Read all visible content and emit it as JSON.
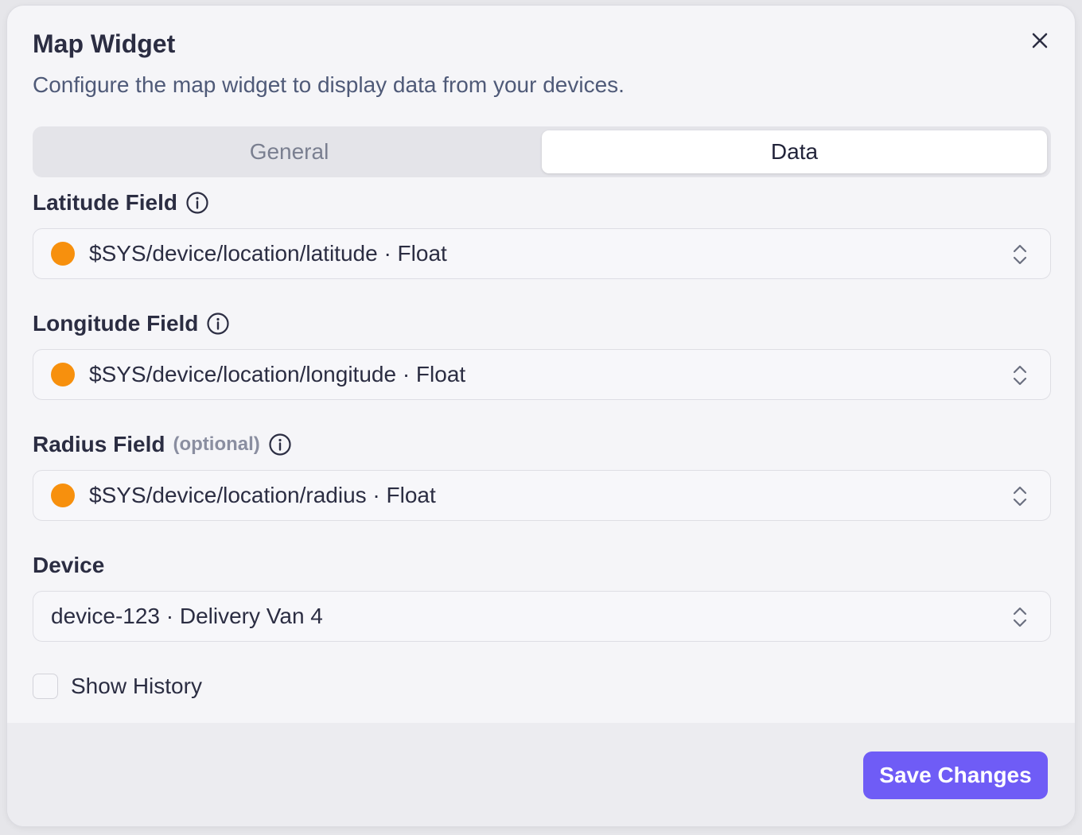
{
  "dialog": {
    "title": "Map Widget",
    "subtitle": "Configure the map widget to display data from your devices."
  },
  "tabs": [
    {
      "label": "General",
      "active": false
    },
    {
      "label": "Data",
      "active": true
    }
  ],
  "fields": {
    "latitude": {
      "label": "Latitude Field",
      "value": "$SYS/device/location/latitude · Float",
      "dot_color": "#f7900d"
    },
    "longitude": {
      "label": "Longitude Field",
      "value": "$SYS/device/location/longitude · Float",
      "dot_color": "#f7900d"
    },
    "radius": {
      "label": "Radius Field",
      "optional": "(optional)",
      "value": "$SYS/device/location/radius · Float",
      "dot_color": "#f7900d"
    },
    "device": {
      "label": "Device",
      "value": "device-123 · Delivery Van 4"
    }
  },
  "show_history": {
    "label": "Show History",
    "checked": false
  },
  "footer": {
    "save_label": "Save Changes"
  },
  "colors": {
    "accent": "#6f5cf6",
    "dot": "#f7900d"
  }
}
